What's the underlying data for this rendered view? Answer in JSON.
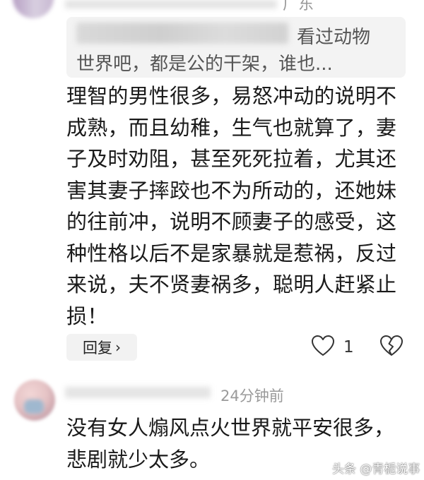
{
  "top_comment": {
    "location_fragment": "广东"
  },
  "quoted_reply": {
    "line1": "看过动物",
    "line2": "世界吧，都是公的干架，谁也..."
  },
  "main_comment": {
    "lines": [
      "理智的男性很多，易怒冲动的说明不",
      "成熟，而且幼稚，生气也就算了，妻",
      "子及时劝阻，甚至死死拉着，尤其还",
      "害其妻子摔跤也不为所动的，还她妹",
      "的往前冲，说明不顾妻子的感受，这",
      "种性格以后不是家暴就是惹祸，反过",
      "来说，夫不贤妻祸多，聪明人赶紧止",
      "损！"
    ],
    "reply_label": "回复",
    "reply_chevron": "›",
    "like_count": "1",
    "icons": {
      "like": "like-heart-icon",
      "dislike": "broken-heart-icon"
    }
  },
  "second_comment": {
    "time": "24分钟前",
    "lines": [
      "没有女人煽风点火世界就平安很多，",
      "悲剧就少太多。"
    ]
  },
  "watermark": "头条 @青栀说事"
}
